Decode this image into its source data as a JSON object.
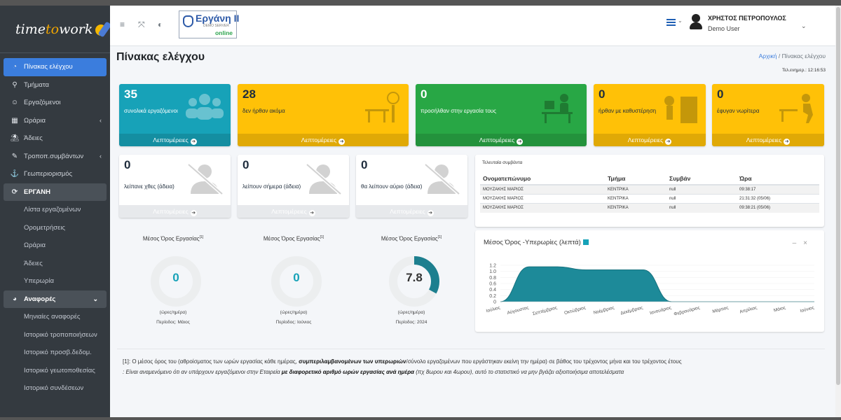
{
  "app": {
    "logo_pre": "time",
    "logo_mid": "to",
    "logo_post": "work"
  },
  "sidebar": {
    "items": [
      {
        "label": "Πίνακας ελέγχου",
        "icon": "dashboard-icon",
        "glyph": "◔"
      },
      {
        "label": "Τμήματα",
        "icon": "sitemap-icon",
        "glyph": "⚲"
      },
      {
        "label": "Εργαζόμενοι",
        "icon": "users-icon",
        "glyph": "👥"
      },
      {
        "label": "Ωράρια",
        "icon": "calendar-icon",
        "glyph": "▦"
      },
      {
        "label": "Άδειες",
        "icon": "beach-icon",
        "glyph": "⛱"
      },
      {
        "label": "Τροποπ.συμβάντων",
        "icon": "edit-icon",
        "glyph": "✎"
      },
      {
        "label": "Γεωπεριορισμός",
        "icon": "anchor-icon",
        "glyph": "⚓"
      },
      {
        "label": "ΕΡΓΑΝΗ",
        "icon": "sync-icon",
        "glyph": "⟳"
      },
      {
        "label": "Λίστα εργαζομένων"
      },
      {
        "label": "Ορομετρήσεις"
      },
      {
        "label": "Ωράρια"
      },
      {
        "label": "Άδειες"
      },
      {
        "label": "Υπερωρία"
      },
      {
        "label": "Αναφορές",
        "icon": "pie-chart-icon",
        "glyph": "◕"
      },
      {
        "label": "Μηνιαίες αναφορές"
      },
      {
        "label": "Ιστορικό τροποποιήσεων"
      },
      {
        "label": "Ιστορικό προσβ.δεδομ."
      },
      {
        "label": "Ιστορικό γεωτοποθεσίας"
      },
      {
        "label": "Ιστορικό συνδέσεων"
      }
    ]
  },
  "topbar": {
    "ergani_title": "Εργάνη II",
    "ergani_sub": "DEMO SERVER",
    "ergani_online": "online",
    "user_name": "ΧΡΗΣΤΟΣ ΠΕΤΡΟΠΟΥΛΟΣ",
    "user_role": "Demo User"
  },
  "page": {
    "title": "Πίνακας ελέγχου",
    "crumb_home": "Αρχική",
    "crumb_sep": "/",
    "crumb_current": "Πίνακας ελέγχου",
    "updated": "Τελ.ενημερ.: 12:16:53"
  },
  "more_label": "Λεπτομέρειες",
  "stats": [
    {
      "value": "35",
      "label": "συνολικά εργαζόμενοι",
      "color": "#17a2b8"
    },
    {
      "value": "28",
      "label": "δεν ήρθαν ακόμα",
      "color": "#ffc107"
    },
    {
      "value": "0",
      "label": "προσήλθαν στην εργασία τους",
      "color": "#28a745"
    },
    {
      "value": "0",
      "label": "ήρθαν με καθυστέρηση",
      "color": "#ffc107"
    },
    {
      "value": "0",
      "label": "έφυγαν νωρίτερα",
      "color": "#ffc107"
    }
  ],
  "leave": [
    {
      "value": "0",
      "label": "λείπανε χθες (άδεια)"
    },
    {
      "value": "0",
      "label": "λείπουν σήμερα (άδεια)"
    },
    {
      "value": "0",
      "label": "θα λείπουν αύριο (άδεια)"
    }
  ],
  "events": {
    "title": "Τελευταία συμβάντα",
    "headers": [
      "Ονοματεπώνυμο",
      "Τμήμα",
      "Συμβάν",
      "Ώρα"
    ],
    "rows": [
      [
        "ΜΟΥΖΑΚΗΣ ΜΑΡΙΟΣ",
        "ΚΕΝΤΡΙΚΑ",
        "null",
        "09:38:17"
      ],
      [
        "ΜΟΥΖΑΚΗΣ ΜΑΡΙΟΣ",
        "ΚΕΝΤΡΙΚΑ",
        "null",
        "21:31:32 (05/06)"
      ],
      [
        "ΜΟΥΖΑΚΗΣ ΜΑΡΙΟΣ",
        "ΚΕΝΤΡΙΚΑ",
        "null",
        "09:38:21 (05/06)"
      ]
    ]
  },
  "donuts": [
    {
      "title": "Μέσος Όρος Εργασίας",
      "sup": "[1]",
      "value": "0",
      "fraction": 0,
      "unit": "(ώρες/ημέρα)",
      "period": "Περίοδος: Μάιος"
    },
    {
      "title": "Μέσος Όρος Εργασίας",
      "sup": "[1]",
      "value": "0",
      "fraction": 0,
      "unit": "(ώρες/ημέρα)",
      "period": "Περίοδος: Ιούνιος"
    },
    {
      "title": "Μέσος Όρος Εργασίας",
      "sup": "[1]",
      "value": "7.8",
      "fraction": 0.33,
      "unit": "(ώρες/ημέρα)",
      "period": "Περίοδος: 2024"
    }
  ],
  "chart_data": {
    "type": "area",
    "title": "Μέσος Όρος -Υπερωρίες (λεπτά)",
    "categories": [
      "Ιούλιος",
      "Αύγουστος",
      "Σεπτέμβριος",
      "Οκτώβριος",
      "Νοέμβριος",
      "Δεκέμβριος",
      "Ιανουάριος",
      "Φεβρουάριος",
      "Μάρτιος",
      "Απρίλιος",
      "Μάιος",
      "Ιούνιος"
    ],
    "series": [
      {
        "values": [
          0,
          1.15,
          1.15,
          1.05,
          1.05,
          1.05,
          0,
          0,
          0,
          0,
          0,
          0
        ]
      }
    ],
    "yticks": [
      "0",
      "0.2",
      "0.4",
      "0.6",
      "0.8",
      "1.0",
      "1.2"
    ],
    "ylim": [
      0,
      1.2
    ],
    "color": "#1d8a99"
  },
  "footnote": {
    "l1a": "[1]: Ο μέσος όρος του (αθροίσματος των ωρών εργασίας κάθε ημέρας, ",
    "l1b": "συμπεριλαμβανομένων των υπερωριών",
    "l1c": "/σύνολο εργαζομένων που εργάστηκαν εκείνη την ημέρα) σε βάθος του τρέχοντος μήνα και του τρέχοντος έτους",
    "l2a": ": Είναι αναμενόμενο ότι αν υπάρχουν εργαζόμενοι στην Εταιρεία ",
    "l2b": "με διαφορετικό αριθμό ωρών εργασίας ανά ημέρα",
    "l2c": " (πχ 8ωρου και 4ωρου), αυτό το στατιστικό να μην βγάζει αξιοποιήσιμα αποτελέσματα"
  }
}
